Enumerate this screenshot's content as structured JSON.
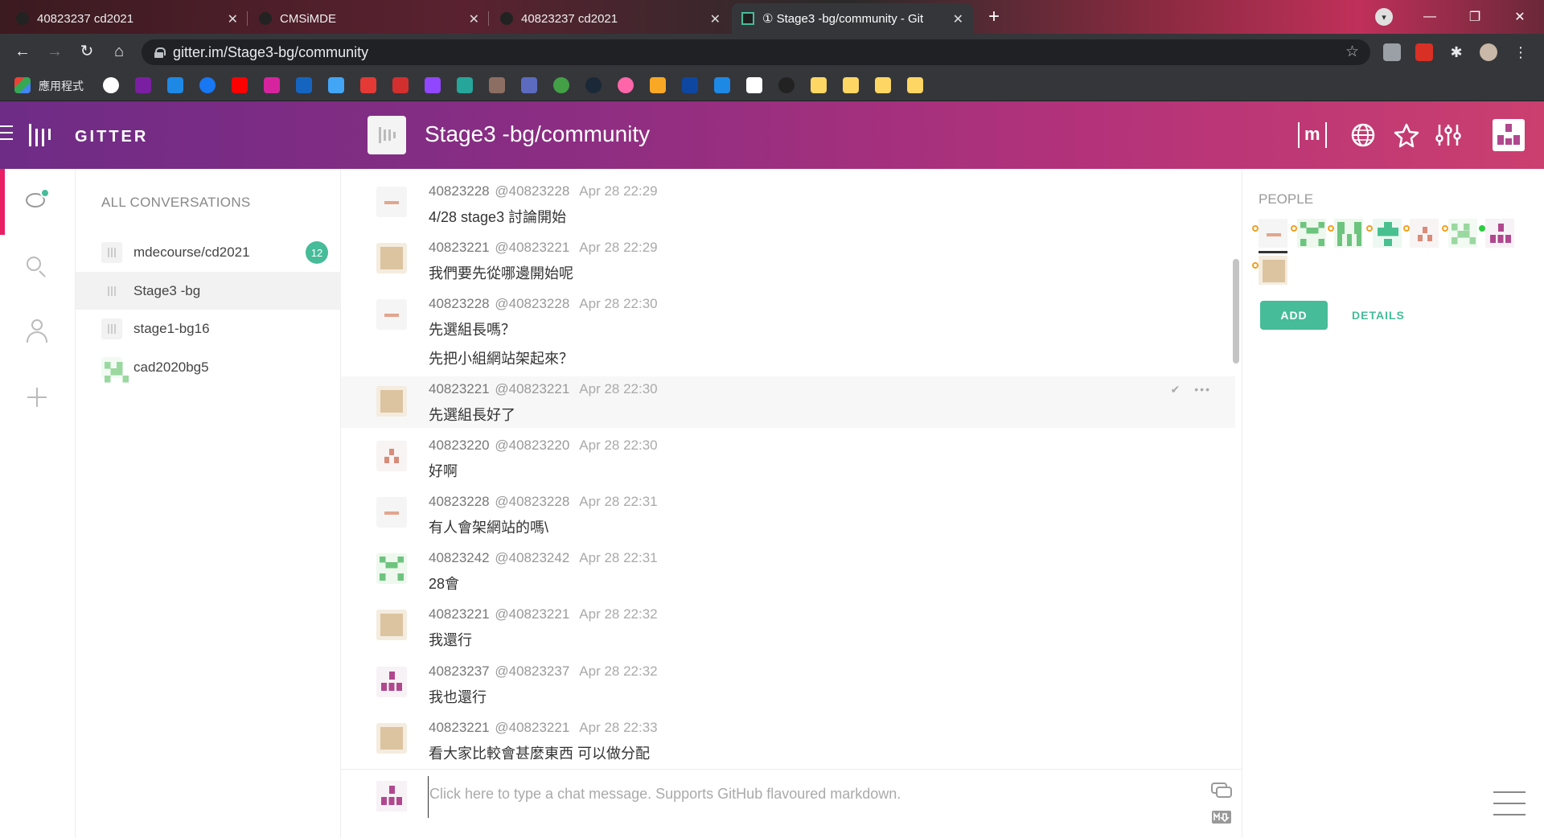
{
  "browser": {
    "tabs": [
      {
        "title": "40823237 cd2021",
        "active": false
      },
      {
        "title": "CMSiMDE",
        "active": false
      },
      {
        "title": "40823237 cd2021",
        "active": false
      },
      {
        "title": "① Stage3 -bg/community - Git",
        "active": true
      }
    ],
    "url": "gitter.im/Stage3-bg/community",
    "bookmarks_apps_label": "應用程式",
    "new_tab_label": "+",
    "window_controls": {
      "minimize": "—",
      "restore": "❐",
      "close": "✕"
    }
  },
  "header": {
    "brand": "GITTER",
    "room_title": "Stage3 -bg/community",
    "matrix_label": "m"
  },
  "conversations": {
    "heading": "ALL CONVERSATIONS",
    "items": [
      {
        "name": "mdecourse/cd2021",
        "badge": "12"
      },
      {
        "name": "Stage3 -bg",
        "badge": ""
      },
      {
        "name": "stage1-bg16",
        "badge": ""
      },
      {
        "name": "cad2020bg5",
        "badge": ""
      }
    ]
  },
  "messages": [
    {
      "name": "40823228",
      "user": "@40823228",
      "time": "Apr 28 22:29",
      "lines": [
        "4/28 stage3 討論開始"
      ],
      "avatar": "dash"
    },
    {
      "name": "40823221",
      "user": "@40823221",
      "time": "Apr 28 22:29",
      "lines": [
        "我們要先從哪邊開始呢"
      ],
      "avatar": "beige"
    },
    {
      "name": "40823228",
      "user": "@40823228",
      "time": "Apr 28 22:30",
      "lines": [
        "先選組長嗎？",
        "先把小組網站架起來？"
      ],
      "avatar": "dash"
    },
    {
      "name": "40823221",
      "user": "@40823221",
      "time": "Apr 28 22:30",
      "lines": [
        "先選組長好了"
      ],
      "avatar": "beige"
    },
    {
      "name": "40823220",
      "user": "@40823220",
      "time": "Apr 28 22:30",
      "lines": [
        "好啊"
      ],
      "avatar": "tri"
    },
    {
      "name": "40823228",
      "user": "@40823228",
      "time": "Apr 28 22:31",
      "lines": [
        "有人會架網站的嗎\\"
      ],
      "avatar": "dash"
    },
    {
      "name": "40823242",
      "user": "@40823242",
      "time": "Apr 28 22:31",
      "lines": [
        "28會"
      ],
      "avatar": "green"
    },
    {
      "name": "40823221",
      "user": "@40823221",
      "time": "Apr 28 22:32",
      "lines": [
        "我還行"
      ],
      "avatar": "beige"
    },
    {
      "name": "40823237",
      "user": "@40823237",
      "time": "Apr 28 22:32",
      "lines": [
        "我也還行"
      ],
      "avatar": "purple"
    },
    {
      "name": "40823221",
      "user": "@40823221",
      "time": "Apr 28 22:33",
      "lines": [
        "看大家比較會甚麼東西 可以做分配"
      ],
      "avatar": "beige"
    }
  ],
  "message_actions": {
    "check": "✔",
    "more": "•••"
  },
  "composer": {
    "placeholder": "Click here to type a chat message. Supports GitHub flavoured markdown."
  },
  "people": {
    "heading": "PEOPLE",
    "add_label": "ADD",
    "details_label": "DETAILS"
  },
  "colors": {
    "accent": "#46bc99",
    "header_start": "#6e2c86",
    "header_end": "#cb3f6f",
    "rail_active": "#e91e63"
  }
}
